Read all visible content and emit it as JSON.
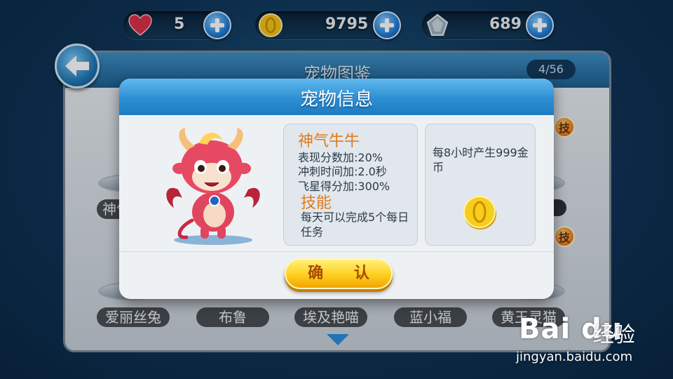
{
  "resources": {
    "lives": "5",
    "coins": "9795",
    "gems": "689"
  },
  "gallery": {
    "title": "宠物图鉴",
    "page_count": "4/56",
    "skill_badge": "技",
    "peek_name": "神气牛牛",
    "pets": [
      "爱丽丝兔",
      "布鲁",
      "埃及艳喵",
      "蓝小福",
      "黄玉灵猫"
    ]
  },
  "modal": {
    "title": "宠物信息",
    "pet_name": "神气牛牛",
    "stats": [
      "表现分数加:20%",
      "冲刺时间加:2.0秒",
      "飞星得分加:300%"
    ],
    "skill_title": "技能",
    "skill_desc": "每天可以完成5个每日任务",
    "income_text": "每8小时产生999金币",
    "confirm_label": "确 认"
  },
  "watermark": {
    "logo": "Bai du",
    "cn": "经验",
    "url": "jingyan.baidu.com"
  },
  "icons": {
    "lives": "heart-icon",
    "coins": "coin-icon",
    "gems": "gem-icon",
    "back": "back-arrow-icon",
    "more": "chevron-down-icon"
  },
  "colors": {
    "accent": "#2c8fd4",
    "highlight": "#e27a1a",
    "confirm": "#ffcf1f"
  }
}
